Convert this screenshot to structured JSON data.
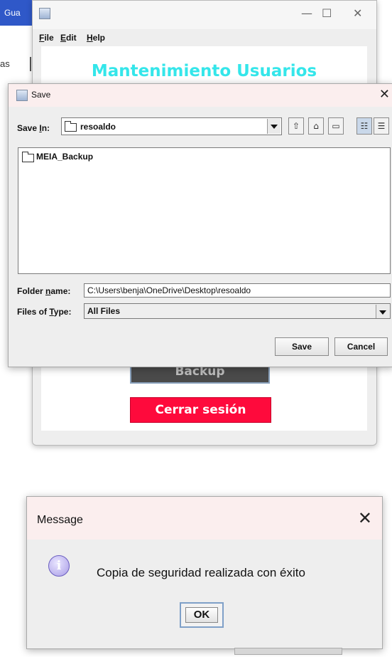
{
  "background": {
    "taskbar_fragment": "Gua",
    "side_fragment": "as",
    "window": {
      "controls": {
        "minimize": "—",
        "maximize": "☐",
        "close": "✕"
      },
      "menu": [
        {
          "letter": "F",
          "rest": "ile"
        },
        {
          "letter": "E",
          "rest": "dit"
        },
        {
          "letter": "H",
          "rest": "elp"
        }
      ],
      "title": "Mantenimiento Usuarios",
      "buttons": {
        "backup": "Backup",
        "logout": "Cerrar sesión"
      }
    }
  },
  "save_dialog": {
    "title": "Save",
    "close_glyph": "✕",
    "save_in_label": {
      "prefix": "Save ",
      "letter": "I",
      "rest": "n:"
    },
    "save_in_value": "resoaldo",
    "toolbar_icons": [
      "up-folder-icon",
      "home-icon",
      "new-folder-icon",
      "list-view-icon",
      "details-view-icon"
    ],
    "toolbar_glyphs": [
      "⇧",
      "⌂",
      "▭",
      "☷",
      "☰"
    ],
    "files": [
      {
        "name": "MEIA_Backup",
        "icon": "folder-icon"
      }
    ],
    "folder_name_label": {
      "prefix": "Folder ",
      "letter": "n",
      "rest": "ame:"
    },
    "folder_name_value": "C:\\Users\\benja\\OneDrive\\Desktop\\resoaldo",
    "files_of_type_label": {
      "prefix": "Files of ",
      "letter": "T",
      "rest": "ype:"
    },
    "files_of_type_value": "All Files",
    "save_button": "Save",
    "cancel_button": "Cancel"
  },
  "message_dialog": {
    "title": "Message",
    "close_glyph": "✕",
    "icon": "info-icon",
    "icon_glyph": "i",
    "text": "Copia de seguridad realizada con éxito",
    "ok_button": "OK"
  },
  "colors": {
    "app_title": "#34e6ea",
    "logout_button": "#fe0a3c",
    "backup_button": "#4a4a4a",
    "dialog_title_bar": "#fbeeee"
  }
}
